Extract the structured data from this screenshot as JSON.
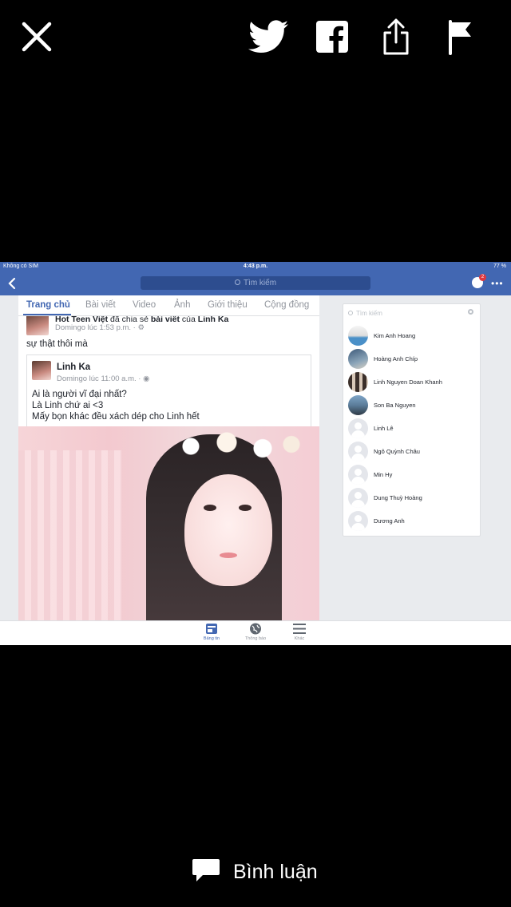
{
  "viewer": {
    "close_icon": "close-icon",
    "twitter_icon": "twitter-icon",
    "facebook_icon": "facebook-icon",
    "share_icon": "share-icon",
    "flag_icon": "flag-icon",
    "comment_label": "Bình luận"
  },
  "screenshot": {
    "status": {
      "carrier": "Không có SIM",
      "time": "4:43 p.m.",
      "battery": "77 %"
    },
    "nav": {
      "search_placeholder": "Tìm kiếm",
      "messenger_badge": "2"
    },
    "tabs": [
      "Trang chủ",
      "Bài viết",
      "Video",
      "Ảnh",
      "Giới thiệu",
      "Cộng đồng"
    ],
    "post": {
      "header_page": "Hot Teen Việt",
      "header_action": " đã chia sẻ ",
      "header_object": "bài viết",
      "header_of": " của ",
      "header_author": "Linh Ka",
      "meta": "Domingo lúc 1:53 p.m. · ",
      "text": "sự thật thôi mà"
    },
    "shared": {
      "name": "Linh Ka",
      "meta": "Domingo lúc 11:00 a.m. · ",
      "line1": "Ai là người vĩ đại nhất?",
      "line2": "Là Linh chứ ai <3",
      "line3": "Mấy bọn khác đều xách dép cho Linh hết"
    },
    "sidebar": {
      "search_placeholder": "Tìm kiếm",
      "contacts": [
        "Kim Anh Hoang",
        "Hoàng Anh Chíp",
        "Linh Nguyen Doan Khanh",
        "Son Ba Nguyen",
        "Linh Lê",
        "Ngô Quỳnh Châu",
        "Min Hy",
        "Dung Thuỳ Hoàng",
        "Dương Anh"
      ]
    },
    "tabbar": {
      "news": "Bảng tin",
      "notifications": "Thông báo",
      "more": "Khác"
    }
  },
  "colors": {
    "fb_blue": "#4267b2",
    "background": "#000000"
  }
}
